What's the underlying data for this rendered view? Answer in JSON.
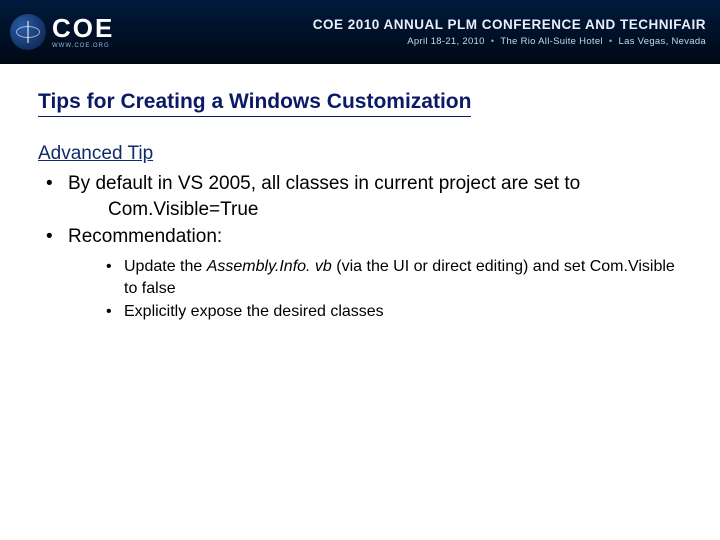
{
  "banner": {
    "logo_text": "COE",
    "logo_sub": "WWW.COE.ORG",
    "title": "COE 2010 ANNUAL PLM CONFERENCE AND TECHNIFAIR",
    "date": "April 18-21, 2010",
    "venue": "The Rio All-Suite Hotel",
    "city": "Las Vegas, Nevada"
  },
  "slide": {
    "title": "Tips for Creating a Windows Customization",
    "subhead": "Advanced Tip",
    "b1_a": "By default in VS 2005, all classes in current project are set to",
    "b1_b": "Com.Visible=True",
    "b2": "Recommendation:",
    "s1_a": "Update the ",
    "s1_ital": "Assembly.Info. vb ",
    "s1_b": "(via the UI or direct editing) and set Com.Visible to false",
    "s2": "Explicitly expose the desired classes"
  }
}
